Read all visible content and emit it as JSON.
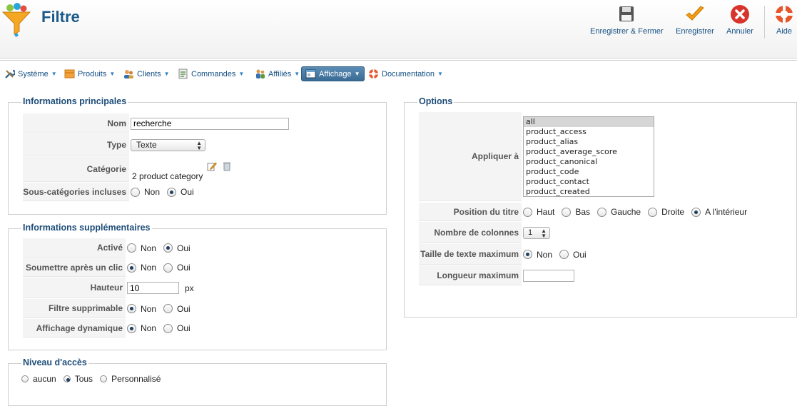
{
  "header": {
    "title": "Filtre",
    "buttons": {
      "save_close": "Enregistrer & Fermer",
      "save": "Enregistrer",
      "cancel": "Annuler",
      "help": "Aide"
    }
  },
  "menu": {
    "systeme": "Système",
    "produits": "Produits",
    "clients": "Clients",
    "commandes": "Commandes",
    "affilies": "Affiliés",
    "affichage": "Affichage",
    "documentation": "Documentation"
  },
  "main_info": {
    "legend": "Informations principales",
    "nom_label": "Nom",
    "nom_value": "recherche",
    "type_label": "Type",
    "type_value": "Texte",
    "categorie_label": "Catégorie",
    "categorie_value": "2 product category",
    "subcat_label": "Sous-catégories incluses",
    "non": "Non",
    "oui": "Oui"
  },
  "extra_info": {
    "legend": "Informations supplémentaires",
    "active_label": "Activé",
    "submit_label": "Soumettre après un clic",
    "height_label": "Hauteur",
    "height_value": "10",
    "height_unit": "px",
    "deletable_label": "Filtre supprimable",
    "dynamic_label": "Affichage dynamique",
    "non": "Non",
    "oui": "Oui"
  },
  "access": {
    "legend": "Niveau d'accès",
    "aucun": "aucun",
    "tous": "Tous",
    "perso": "Personnalisé"
  },
  "options": {
    "legend": "Options",
    "apply_label": "Appliquer à",
    "apply_items": [
      "all",
      "product_access",
      "product_alias",
      "product_average_score",
      "product_canonical",
      "product_code",
      "product_contact",
      "product_created"
    ],
    "title_pos_label": "Position du titre",
    "pos_haut": "Haut",
    "pos_bas": "Bas",
    "pos_gauche": "Gauche",
    "pos_droite": "Droite",
    "pos_interieur": "A l'intérieur",
    "columns_label": "Nombre de colonnes",
    "columns_value": "1",
    "max_text_label": "Taille de texte maximum",
    "non": "Non",
    "oui": "Oui",
    "max_length_label": "Longueur maximum",
    "max_length_value": ""
  }
}
